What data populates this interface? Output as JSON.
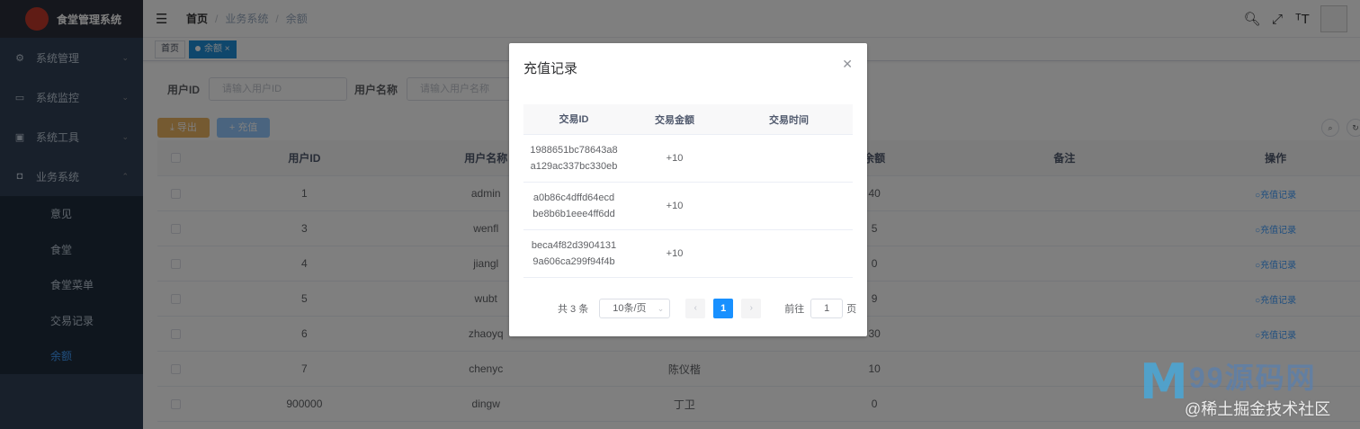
{
  "app": {
    "title": "食堂管理系统"
  },
  "sidebar": {
    "items": [
      {
        "label": "系统管理",
        "icon": "gear-icon"
      },
      {
        "label": "系统监控",
        "icon": "monitor-icon"
      },
      {
        "label": "系统工具",
        "icon": "toolbox-icon"
      },
      {
        "label": "业务系统",
        "icon": "bus-icon"
      }
    ],
    "subitems": [
      {
        "label": "意见"
      },
      {
        "label": "食堂"
      },
      {
        "label": "食堂菜单"
      },
      {
        "label": "交易记录"
      },
      {
        "label": "余额"
      }
    ]
  },
  "breadcrumb": [
    "首页",
    "业务系统",
    "余额"
  ],
  "tags": [
    "首页",
    "余额"
  ],
  "search": {
    "userid_label": "用户ID",
    "userid_placeholder": "请输入用户ID",
    "username_label": "用户名称",
    "username_placeholder": "请输入用户名称"
  },
  "toolbar": {
    "export_label": "导出",
    "recharge_label": "充值"
  },
  "table": {
    "headers": [
      "用户ID",
      "用户名称",
      "",
      "余额",
      "备注",
      "操作"
    ],
    "rows": [
      {
        "id": "1",
        "username": "admin",
        "name": "",
        "balance": "40",
        "op": "充值记录"
      },
      {
        "id": "3",
        "username": "wenfl",
        "name": "",
        "balance": "5",
        "op": "充值记录"
      },
      {
        "id": "4",
        "username": "jiangl",
        "name": "",
        "balance": "0",
        "op": "充值记录"
      },
      {
        "id": "5",
        "username": "wubt",
        "name": "",
        "balance": "9",
        "op": "充值记录"
      },
      {
        "id": "6",
        "username": "zhaoyq",
        "name": "",
        "balance": "30",
        "op": "充值记录"
      },
      {
        "id": "7",
        "username": "chenyc",
        "name": "陈仪楷",
        "balance": "10",
        "op": ""
      },
      {
        "id": "900000",
        "username": "dingw",
        "name": "丁卫",
        "balance": "0",
        "op": ""
      }
    ]
  },
  "dialog": {
    "title": "充值记录",
    "headers": [
      "交易ID",
      "交易金额",
      "交易时间"
    ],
    "rows": [
      {
        "id_line1": "1988651bc78643a8",
        "id_line2": "a129ac337bc330eb",
        "amount": "+10",
        "time": ""
      },
      {
        "id_line1": "a0b86c4dffd64ecd",
        "id_line2": "be8b6b1eee4ff6dd",
        "amount": "+10",
        "time": ""
      },
      {
        "id_line1": "beca4f82d3904131",
        "id_line2": "9a606ca299f94f4b",
        "amount": "+10",
        "time": ""
      }
    ],
    "pager": {
      "total": "共 3 条",
      "page_size": "10条/页",
      "current": "1",
      "goto_prefix": "前往",
      "goto_value": "1",
      "goto_suffix": "页"
    }
  },
  "watermark": {
    "logo": "M",
    "brand": "99源码网",
    "sub": "@稀土掘金技术社区"
  }
}
